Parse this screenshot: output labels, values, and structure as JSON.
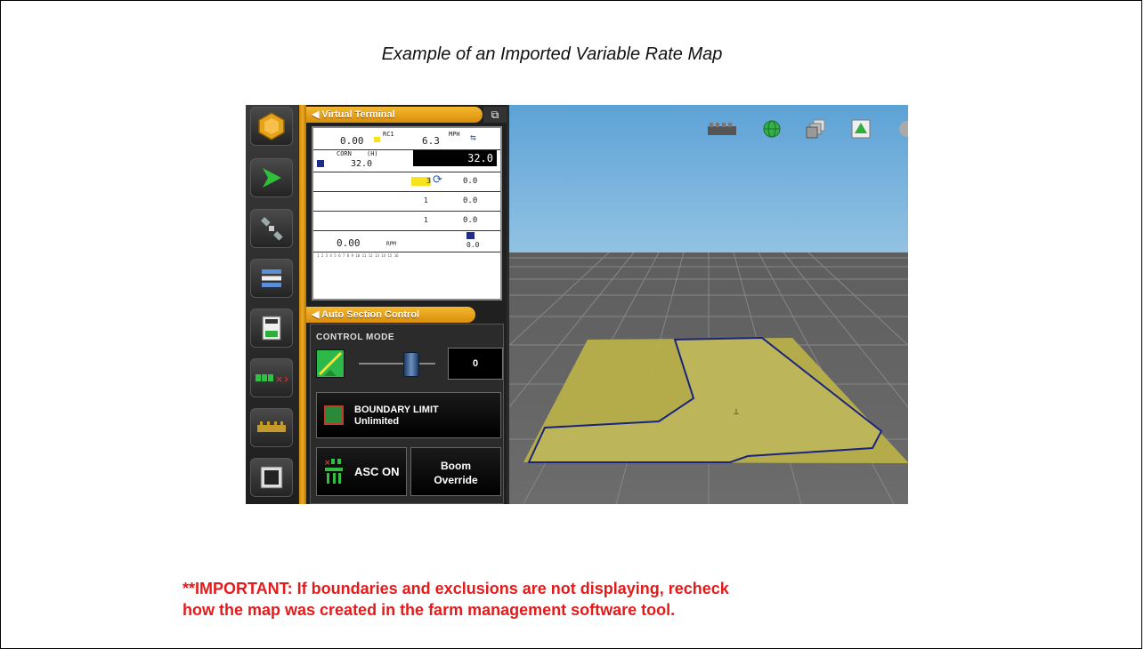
{
  "caption": "Example of an Imported Variable Rate Map",
  "note": {
    "line1": "**IMPORTANT: If boundaries and exclusions are not displaying, recheck",
    "line2": "how the map was created in the farm management software tool."
  },
  "sidebar": {
    "icons": [
      "implement-icon",
      "guidance-arrow-icon",
      "satellite-icon",
      "list-icon",
      "calculator-icon",
      "sections-icon",
      "rate-icon",
      "film-icon"
    ]
  },
  "virtual_terminal": {
    "title": "Virtual Terminal",
    "rows": [
      {
        "a": "0.00",
        "b": "RC1",
        "c": "6.3",
        "d": "MPH"
      },
      {
        "a": "CORN",
        "b": "(H)",
        "c": "32.0",
        "d": "32.0"
      },
      {
        "a": "3",
        "c": "0.0"
      },
      {
        "a": "1",
        "c": "0.0"
      },
      {
        "a": "1",
        "c": "0.0"
      },
      {
        "a": "0.00",
        "b": "RPM",
        "c": "0.0"
      }
    ],
    "scale": "1 2 3 4 5 6 7 8 9 10 11 12 13 14 15 16"
  },
  "asc": {
    "title": "Auto Section Control",
    "control_mode_label": "CONTROL MODE",
    "mode_value": "0",
    "boundary_label": "BOUNDARY LIMIT",
    "boundary_value": "Unlimited",
    "asc_on_label": "ASC ON",
    "boom_override_line1": "Boom",
    "boom_override_line2": "Override"
  },
  "map": {
    "toolbar_icons": [
      "bar-rate-icon",
      "globe-icon",
      "layers-icon",
      "field-view-icon",
      "zoom-icon"
    ],
    "colors": {
      "field_fill": "#b8b04a",
      "boundary": "#1a237e",
      "grid_line": "#8a8a8a"
    }
  },
  "colors": {
    "accent": "#f0a820",
    "note_red": "#e31b1b"
  }
}
